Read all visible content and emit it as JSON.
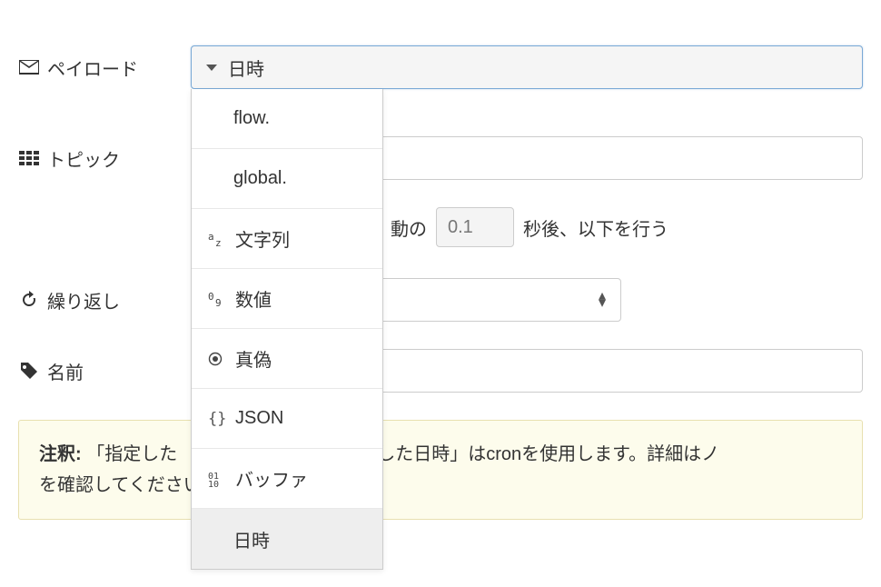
{
  "labels": {
    "payload": "ペイロード",
    "topic": "トピック",
    "repeat": "繰り返し",
    "name": "名前"
  },
  "payload": {
    "selected": "日時",
    "options": [
      {
        "icon": "",
        "label": "flow."
      },
      {
        "icon": "",
        "label": "global."
      },
      {
        "icon": "az",
        "label": "文字列"
      },
      {
        "icon": "09",
        "label": "数値"
      },
      {
        "icon": "bool",
        "label": "真偽"
      },
      {
        "icon": "json",
        "label": "JSON"
      },
      {
        "icon": "buf",
        "label": "バッファ"
      },
      {
        "icon": "",
        "label": "日時",
        "selected": true
      }
    ]
  },
  "delay": {
    "pre_text": "動の",
    "value": "0.1",
    "post_text": "秒後、以下を行う"
  },
  "note": {
    "label": "注釈:",
    "text": "「指定した　　　　　時」と「指定した日時」はcronを使用します。詳細はノ　　　　　　を確認してください。"
  }
}
